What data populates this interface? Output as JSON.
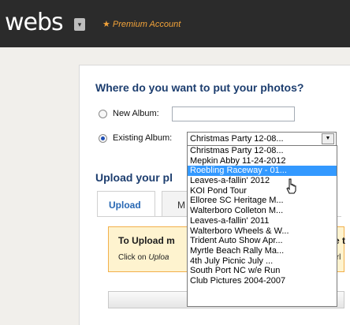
{
  "header": {
    "logo_text": "webs",
    "logo_menu_icon": "dropdown-toggle-icon",
    "premium_star": "★",
    "premium_label": "Premium Account",
    "bg_color": "#2b2b2b",
    "accent_color": "#f2a33a"
  },
  "form": {
    "title": "Where do you want to put your photos?",
    "new_album_label": "New Album:",
    "new_album_value": "",
    "existing_album_label": "Existing Album:",
    "existing_album_selected": "Christmas Party 12-08..."
  },
  "dropdown": {
    "highlight_color": "#3399ff",
    "options": [
      "Christmas Party 12-08...",
      "Mepkin Abby 11-24-2012",
      "Roebling Raceway - 01...",
      "Leaves-a-fallin' 2012",
      "KOI Pond Tour",
      "Elloree SC Heritage M...",
      "Walterboro Colleton M...",
      "Leaves-a-fallin' 2011",
      "Walterboro Wheels & W...",
      "Trident Auto Show Apr...",
      "Myrtle Beach Rally Ma...",
      "4th July Picnic July ...",
      "South Port NC w/e Run",
      "Club Pictures 2004-2007"
    ],
    "highlighted_index": 2
  },
  "upload": {
    "title": "Upload your pl",
    "tabs": [
      {
        "label": "Upload",
        "active": true
      },
      {
        "label": "M",
        "active": false
      }
    ],
    "notice_title": "To Upload m",
    "notice_title_tail": "e t",
    "notice_body_prefix": "Click on ",
    "notice_body_italic": "Uploa",
    "notice_body_tail": "trl",
    "button_label": "Uplo"
  }
}
